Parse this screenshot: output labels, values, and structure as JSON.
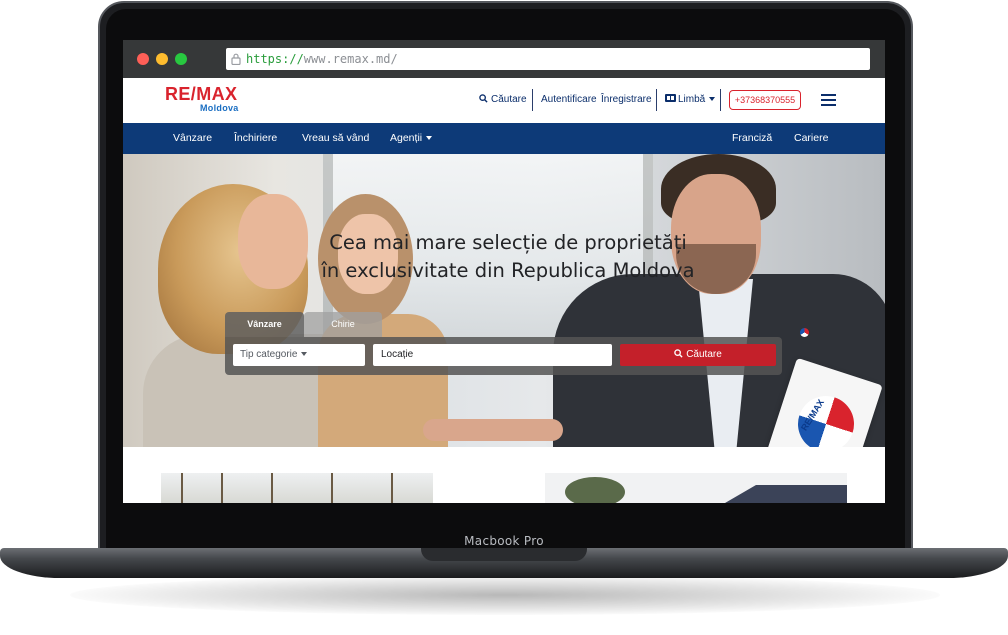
{
  "device": {
    "label": "Macbook Pro"
  },
  "browser": {
    "url_protocol": "https://",
    "url_host": "www.remax.md/"
  },
  "header": {
    "logo_re": "RE/",
    "logo_max": "MAX",
    "logo_sub": "Moldova",
    "search_label": "Căutare",
    "login_label": "Autentificare",
    "register_label": "Înregistrare",
    "language_label": "Limbă",
    "phone": "+37368370555"
  },
  "nav": {
    "items": [
      "Vânzare",
      "Închiriere",
      "Vreau să vând",
      "Agenții"
    ],
    "right_items": [
      "Franciză",
      "Cariere"
    ]
  },
  "hero": {
    "headline_line1": "Cea mai mare selecție de proprietăți",
    "headline_line2": "în exclusivitate din Republica Moldova",
    "sign_text": "RE/MAX"
  },
  "search": {
    "tabs": [
      "Vânzare",
      "Chirie"
    ],
    "category_placeholder": "Tip categorie",
    "location_placeholder": "Locație",
    "button_label": "Căutare"
  },
  "colors": {
    "brand_red": "#d9232d",
    "brand_blue": "#0d3a78",
    "search_red": "#c4202a"
  }
}
